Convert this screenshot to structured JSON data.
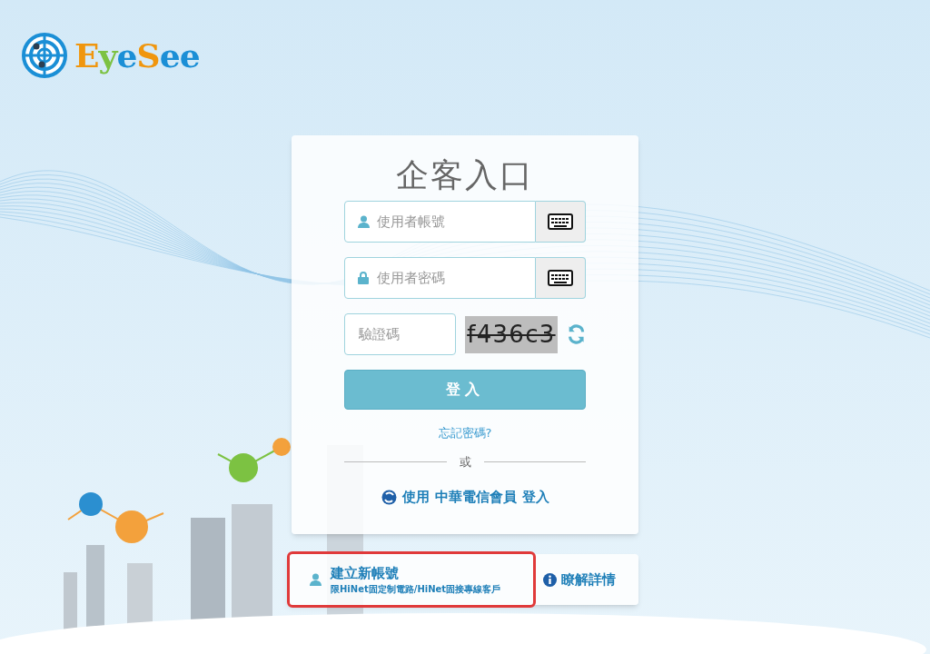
{
  "logo": {
    "parts": [
      {
        "text": "E",
        "color": "#f0960e"
      },
      {
        "text": "y",
        "color": "#7cc242"
      },
      {
        "text": "e",
        "color": "#1b8fd6"
      },
      {
        "text": "S",
        "color": "#f0960e"
      },
      {
        "text": "ee",
        "color": "#1b8fd6"
      }
    ]
  },
  "login": {
    "title": "企客入口",
    "fields": [
      {
        "kind": "user",
        "placeholder": "使用者帳號"
      },
      {
        "kind": "password",
        "placeholder": "使用者密碼"
      }
    ],
    "captcha": {
      "placeholder": "驗證碼",
      "code": "f436c3"
    },
    "submit": "登入",
    "forgot": "忘記密碼?",
    "divider": "或",
    "alt_login": [
      "使用",
      "中華電信會員",
      "登入"
    ]
  },
  "footer": {
    "create_title": "建立新帳號",
    "create_note": "限HiNet固定制電路/HiNet固接專線客戶",
    "highlighted": true,
    "details": "瞭解詳情"
  }
}
